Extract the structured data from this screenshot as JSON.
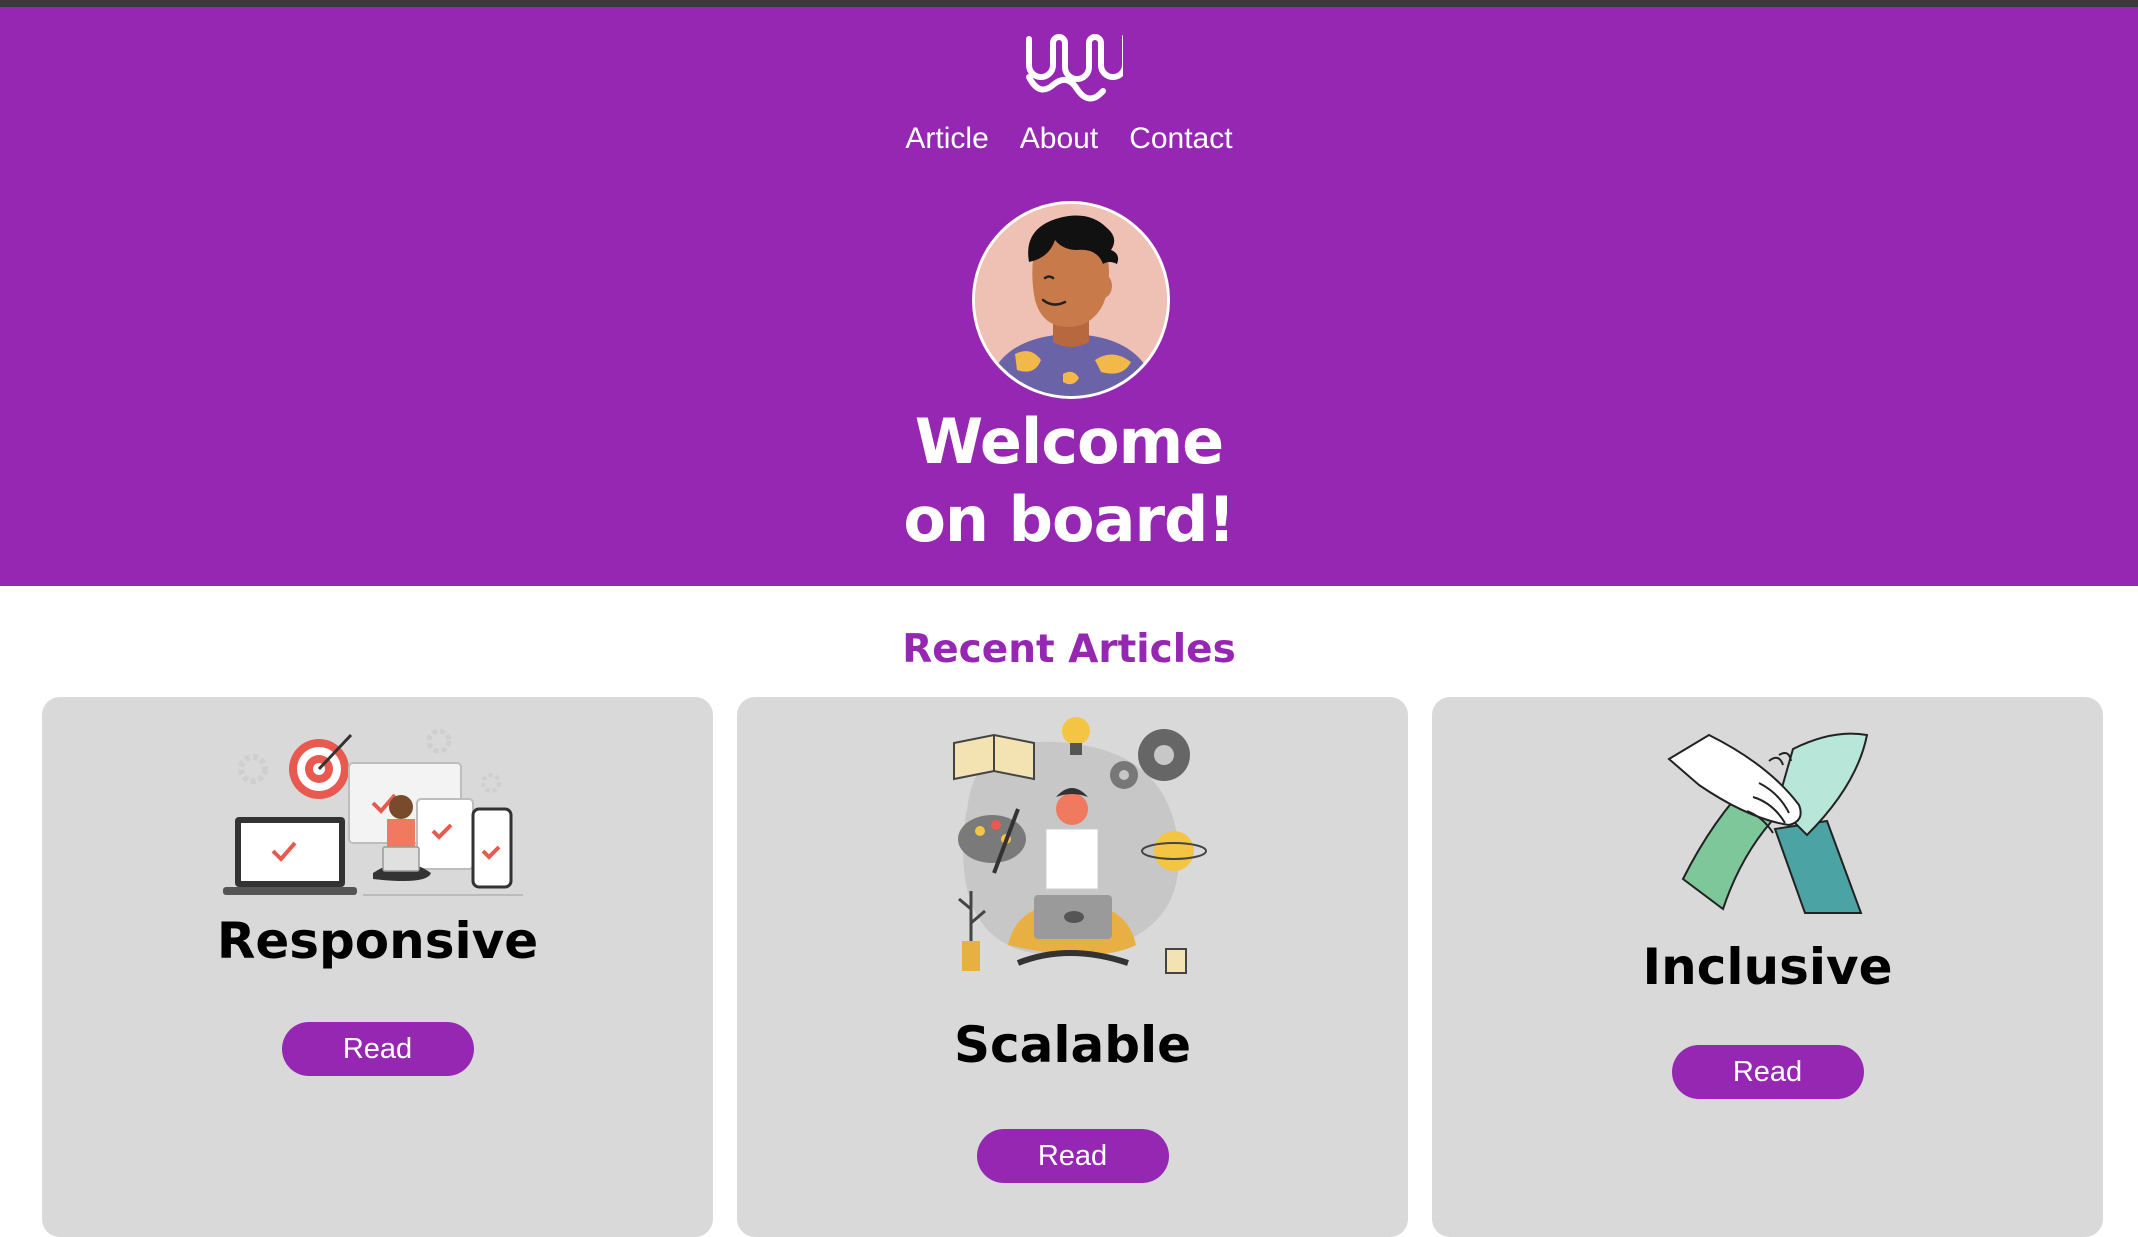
{
  "nav": {
    "items": [
      {
        "label": "Article"
      },
      {
        "label": "About"
      },
      {
        "label": "Contact"
      }
    ]
  },
  "hero": {
    "title_line1": "Welcome",
    "title_line2": "on board!"
  },
  "articles": {
    "heading": "Recent Articles",
    "cards": [
      {
        "title": "Responsive",
        "button": "Read"
      },
      {
        "title": "Scalable",
        "button": "Read"
      },
      {
        "title": "Inclusive",
        "button": "Read"
      }
    ]
  },
  "colors": {
    "brand_purple": "#9627b3",
    "card_bg": "#d9d9d9",
    "text_dark": "#000000",
    "text_light": "#ffffff"
  },
  "icons": {
    "logo": "wave-logo-icon",
    "avatar": "person-avatar",
    "card1": "responsive-devices-illustration",
    "card2": "scalable-ideas-illustration",
    "card3": "inclusive-hands-illustration"
  }
}
